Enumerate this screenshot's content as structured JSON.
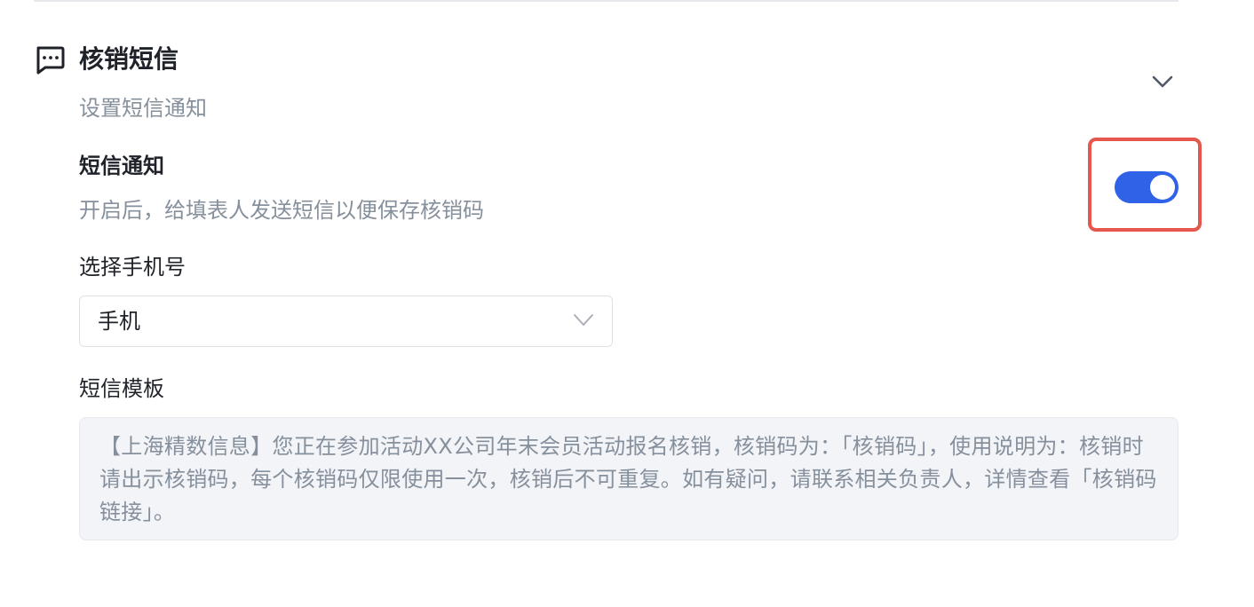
{
  "section": {
    "icon": "message-dots-icon",
    "title": "核销短信",
    "subtitle": "设置短信通知",
    "collapse_icon": "chevron-down-icon"
  },
  "sms_notify": {
    "label": "短信通知",
    "description": "开启后，给填表人发送短信以便保存核销码",
    "enabled": true,
    "accent_color": "#2f62e6",
    "highlight_color": "#e5574d"
  },
  "phone_select": {
    "label": "选择手机号",
    "value": "手机",
    "chevron_icon": "chevron-down-icon"
  },
  "sms_template": {
    "label": "短信模板",
    "text": "【上海精数信息】您正在参加活动XX公司年末会员活动报名核销，核销码为：「核销码」，使用说明为：核销时请出示核销码，每个核销码仅限使用一次，核销后不可重复。如有疑问，请联系相关负责人，详情查看「核销码链接」。"
  }
}
